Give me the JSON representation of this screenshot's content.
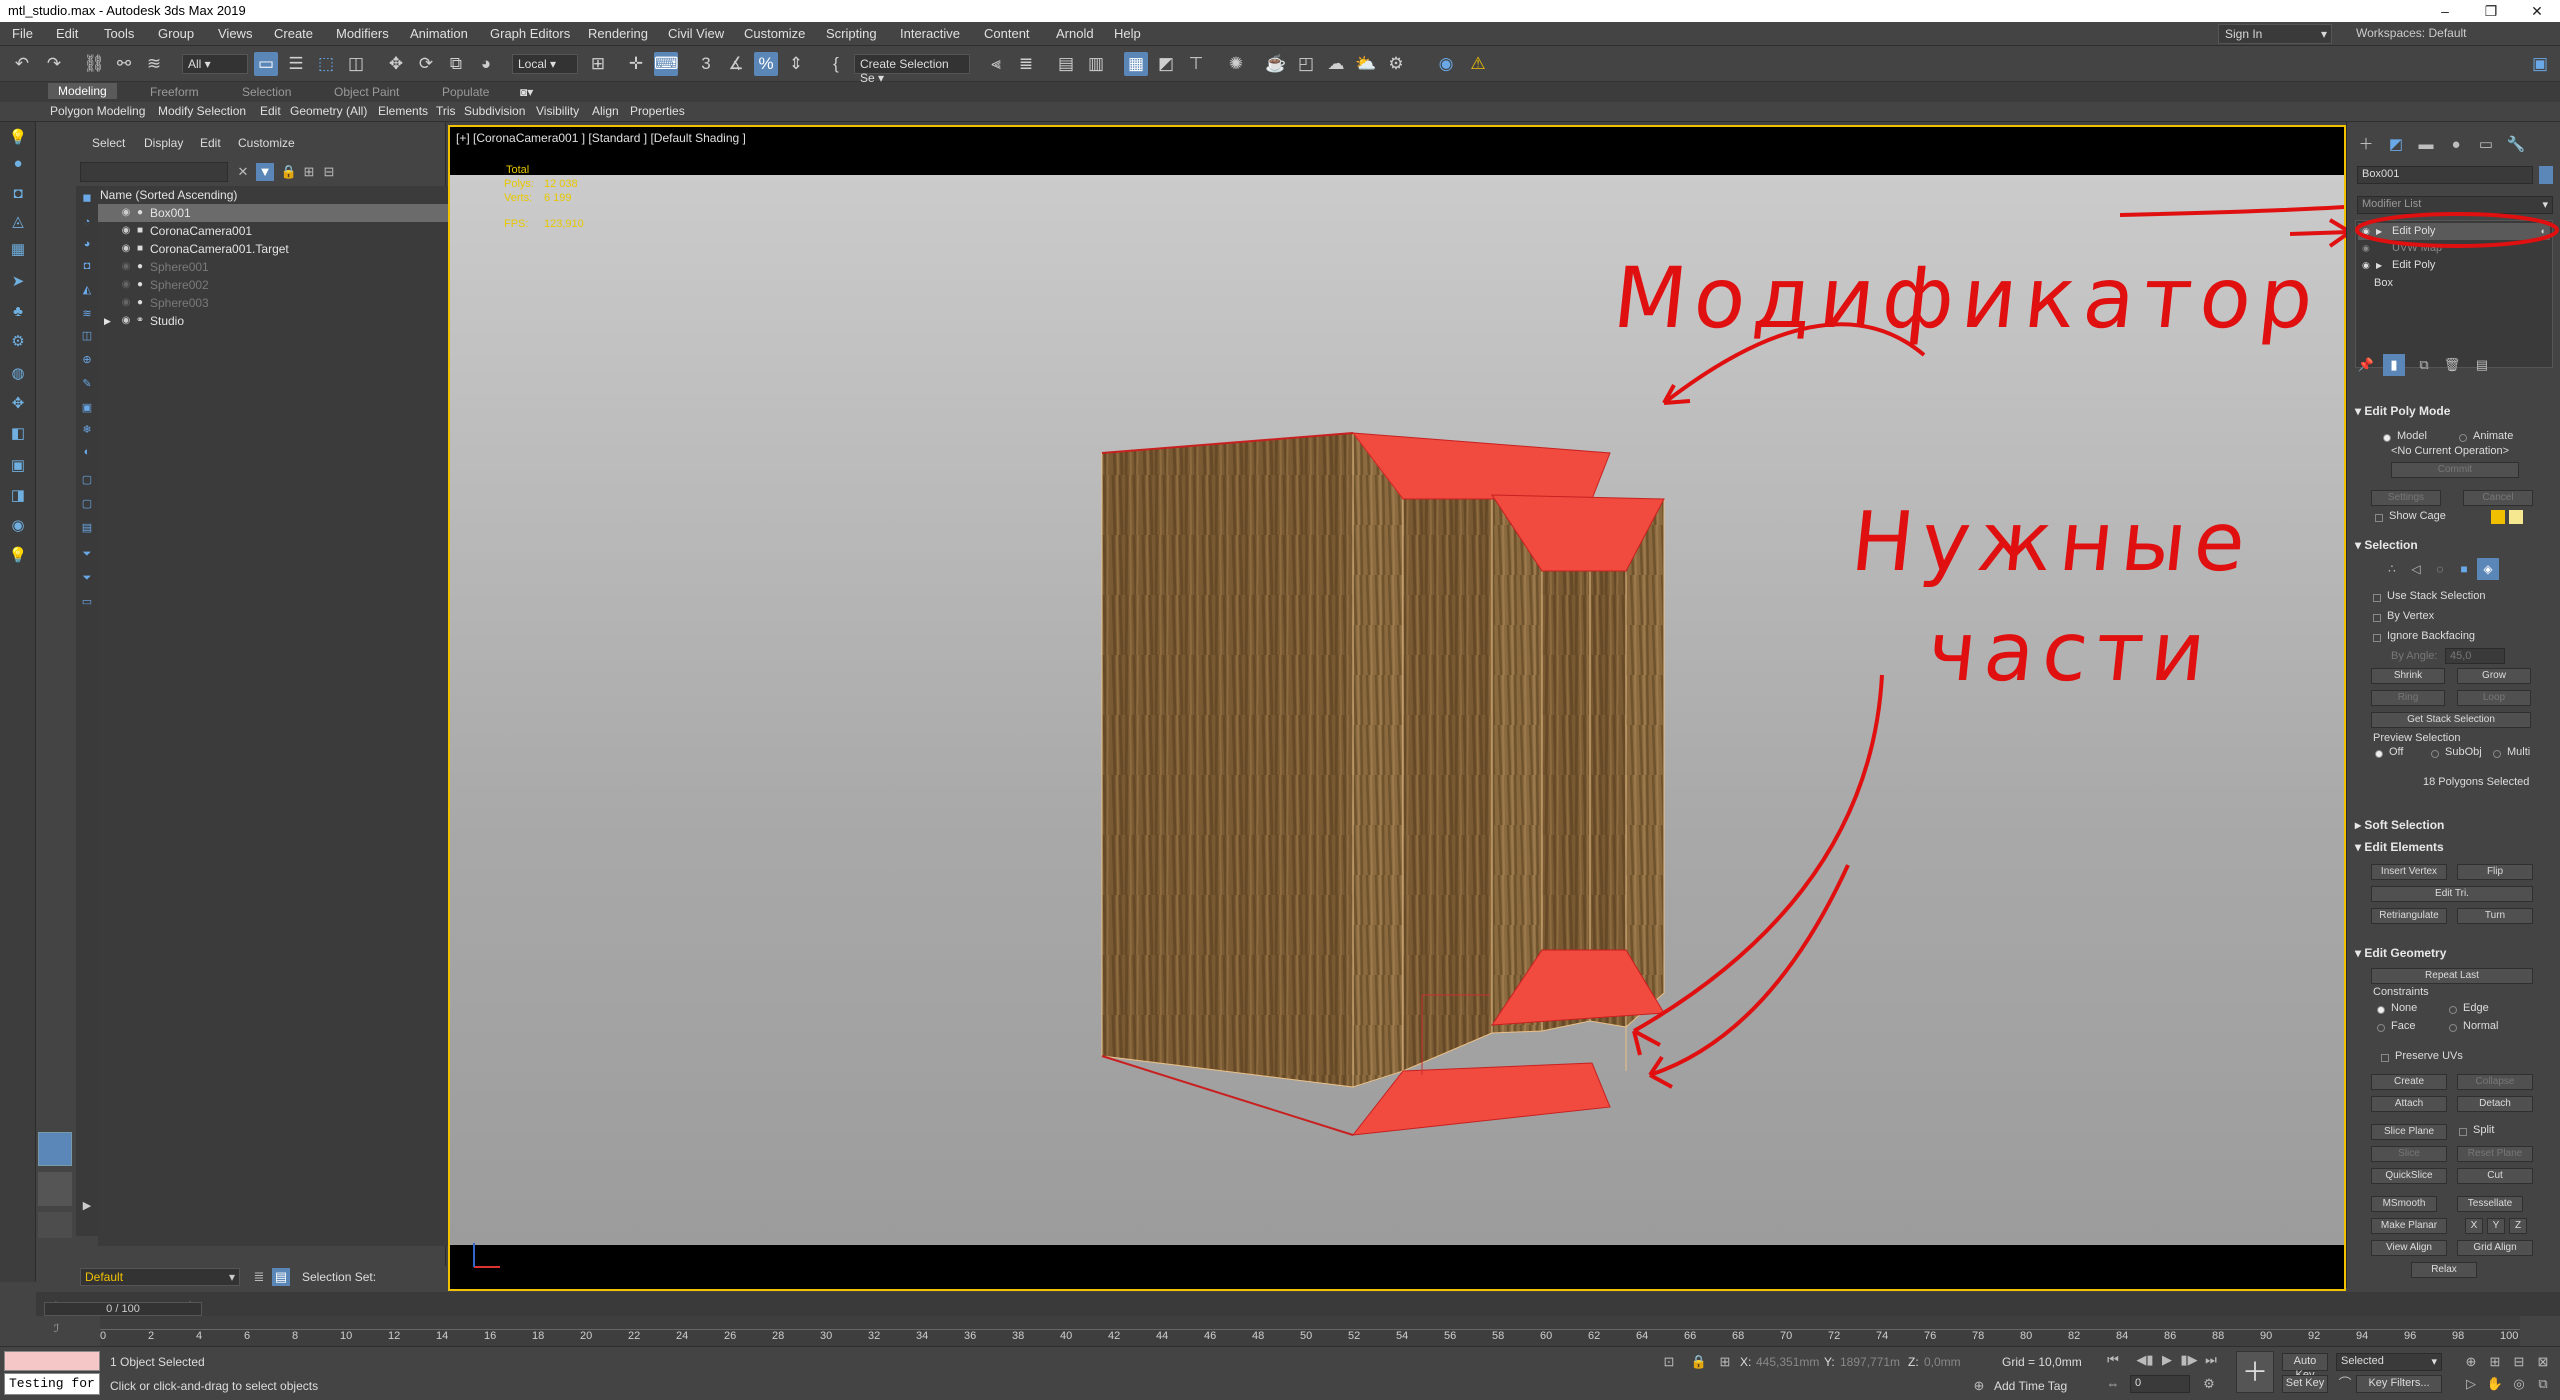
{
  "titlebar": {
    "title": "mtl_studio.max - Autodesk 3ds Max 2019"
  },
  "menu": [
    "File",
    "Edit",
    "Tools",
    "Group",
    "Views",
    "Create",
    "Modifiers",
    "Animation",
    "Graph Editors",
    "Rendering",
    "Civil View",
    "Customize",
    "Scripting",
    "Interactive",
    "Content",
    "Arnold",
    "Help"
  ],
  "account": {
    "signin": "Sign In",
    "workspaces_label": "Workspaces:",
    "workspace": "Default"
  },
  "toolbar": {
    "filter": "All",
    "coord": "Local",
    "selset": "Create Selection Se"
  },
  "ribbon": {
    "tabs": [
      "Modeling",
      "Freeform",
      "Selection",
      "Object Paint",
      "Populate"
    ],
    "sub": [
      "Polygon Modeling",
      "Modify Selection",
      "Edit",
      "Geometry (All)",
      "Elements",
      "Tris",
      "Subdivision",
      "Visibility",
      "Align",
      "Properties"
    ]
  },
  "explorer": {
    "menu": [
      "Select",
      "Display",
      "Edit",
      "Customize"
    ],
    "header": "Name (Sorted Ascending)",
    "rows": [
      "Box001",
      "CoronaCamera001",
      "CoronaCamera001.Target",
      "Sphere001",
      "Sphere002",
      "Sphere003",
      "Studio"
    ]
  },
  "layer": {
    "name": "Default",
    "selection_set": "Selection Set:"
  },
  "viewport": {
    "label": "[+] [CoronaCamera001 ] [Standard ] [Default Shading ]",
    "stats": {
      "total": "Total",
      "polys_label": "Polys:",
      "polys": "12 038",
      "verts_label": "Verts:",
      "verts": "6 199",
      "fps_label": "FPS:",
      "fps": "123,910"
    },
    "annotation_modifier": "Модификатор",
    "annotation_parts_1": "Нужные",
    "annotation_parts_2": "части"
  },
  "command_panel": {
    "object_name": "Box001",
    "modifier_list": "Modifier List",
    "stack": [
      "Edit Poly",
      "UVW Map",
      "Edit Poly",
      "Box"
    ],
    "edit_poly_mode": {
      "title": "Edit Poly Mode",
      "model": "Model",
      "animate": "Animate",
      "op": "<No Current Operation>",
      "commit": "Commit",
      "settings": "Settings",
      "cancel": "Cancel",
      "show_cage": "Show Cage"
    },
    "selection": {
      "title": "Selection",
      "use_stack": "Use Stack Selection",
      "by_vertex": "By Vertex",
      "ignore_backfacing": "Ignore Backfacing",
      "by_angle": "By Angle:",
      "angle": "45,0",
      "shrink": "Shrink",
      "grow": "Grow",
      "ring": "Ring",
      "loop": "Loop",
      "get_stack": "Get Stack Selection",
      "preview": "Preview Selection",
      "off": "Off",
      "subobj": "SubObj",
      "multi": "Multi",
      "count": "18 Polygons Selected"
    },
    "soft_selection": "Soft Selection",
    "edit_elements": {
      "title": "Edit Elements",
      "insert_vertex": "Insert Vertex",
      "flip": "Flip",
      "edit_tri": "Edit Tri.",
      "retriangulate": "Retriangulate",
      "turn": "Turn"
    },
    "edit_geometry": {
      "title": "Edit Geometry",
      "repeat_last": "Repeat Last",
      "constraints": "Constraints",
      "none": "None",
      "edge": "Edge",
      "face": "Face",
      "normal": "Normal",
      "preserve_uvs": "Preserve UVs",
      "create": "Create",
      "collapse": "Collapse",
      "attach": "Attach",
      "detach": "Detach",
      "slice_plane": "Slice Plane",
      "split": "Split",
      "slice": "Slice",
      "reset_plane": "Reset Plane",
      "quickslice": "QuickSlice",
      "cut": "Cut",
      "msmooth": "MSmooth",
      "tessellate": "Tessellate",
      "make_planar": "Make Planar",
      "x": "X",
      "y": "Y",
      "z": "Z",
      "view_align": "View Align",
      "grid_align": "Grid Align",
      "relax": "Relax"
    }
  },
  "timeline": {
    "frame": "0 / 100",
    "ticks": [
      "0",
      "2",
      "4",
      "6",
      "8",
      "10",
      "12",
      "14",
      "16",
      "18",
      "20",
      "22",
      "24",
      "26",
      "28",
      "30",
      "32",
      "34",
      "36",
      "38",
      "40",
      "42",
      "44",
      "46",
      "48",
      "50",
      "52",
      "54",
      "56",
      "58",
      "60",
      "62",
      "64",
      "66",
      "68",
      "70",
      "72",
      "74",
      "76",
      "78",
      "80",
      "82",
      "84",
      "86",
      "88",
      "90",
      "92",
      "94",
      "96",
      "98",
      "100"
    ]
  },
  "status": {
    "maxscript": "Testing for",
    "selected": "1 Object Selected",
    "hint": "Click or click-and-drag to select objects",
    "x_label": "X:",
    "x": "445,351mm",
    "y_label": "Y:",
    "y": "1897,771m",
    "z_label": "Z:",
    "z": "0,0mm",
    "grid": "Grid = 10,0mm",
    "add_time_tag": "Add Time Tag",
    "auto_key": "Auto Key",
    "set_key": "Set Key",
    "selected_dd": "Selected",
    "key_filters": "Key Filters...",
    "frame_field": "0"
  },
  "colors": {
    "accent": "#f2c200",
    "annotation": "#e01010",
    "selection": "#f14a3e",
    "wood": "#7a5a32",
    "active": "#5b87b8"
  }
}
